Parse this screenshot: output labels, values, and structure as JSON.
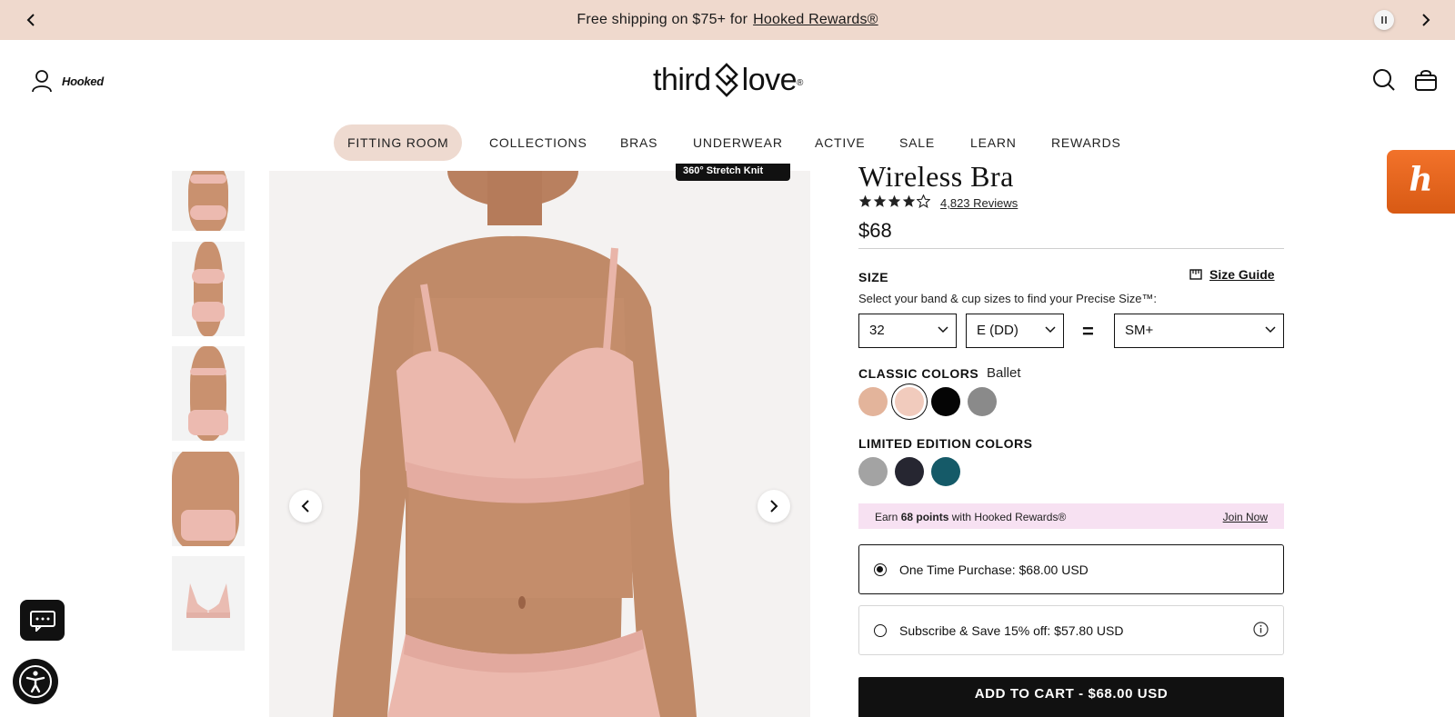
{
  "announcement": {
    "text": "Free shipping on $75+ for",
    "link": "Hooked Rewards®"
  },
  "header": {
    "account_label": "Hooked",
    "logo_left": "third",
    "logo_right": "love",
    "logo_mark": "®"
  },
  "nav": {
    "items": [
      "FITTING ROOM",
      "COLLECTIONS",
      "BRAS",
      "UNDERWEAR",
      "ACTIVE",
      "SALE",
      "LEARN",
      "REWARDS"
    ]
  },
  "gallery": {
    "badge": "360° Stretch Knit"
  },
  "product": {
    "title": "Wireless Bra",
    "rating": 4.0,
    "reviews": "4,823 Reviews",
    "price": "$68"
  },
  "size": {
    "label": "SIZE",
    "guide": "Size Guide",
    "hint": "Select your band & cup sizes to find your Precise Size™:",
    "band": "32",
    "cup": "E (DD)",
    "equals": "=",
    "precise": "SM+"
  },
  "classic_colors": {
    "label": "CLASSIC COLORS",
    "selected_name": "Ballet",
    "swatches": [
      "#e3b49b",
      "#f1cbbd",
      "#050505",
      "#8a8a8a"
    ]
  },
  "limited_colors": {
    "label": "LIMITED EDITION COLORS",
    "swatches": [
      "#a3a3a3",
      "#262631",
      "#155a68"
    ]
  },
  "rewards": {
    "prefix": "Earn",
    "points": "68 points",
    "suffix": "with Hooked Rewards®",
    "join": "Join Now"
  },
  "purchase": {
    "one_time": "One Time Purchase: $68.00 USD",
    "subscribe": "Subscribe & Save 15% off: $57.80 USD"
  },
  "cart": {
    "button": "ADD TO CART - $68.00 USD"
  },
  "extension": {
    "honey_glyph": "h"
  },
  "colors": {
    "announce_bg": "#efd9cd",
    "pill_bg": "#eedad0",
    "rewards_bg": "#f7e1f2",
    "honey": "#e8661e"
  }
}
